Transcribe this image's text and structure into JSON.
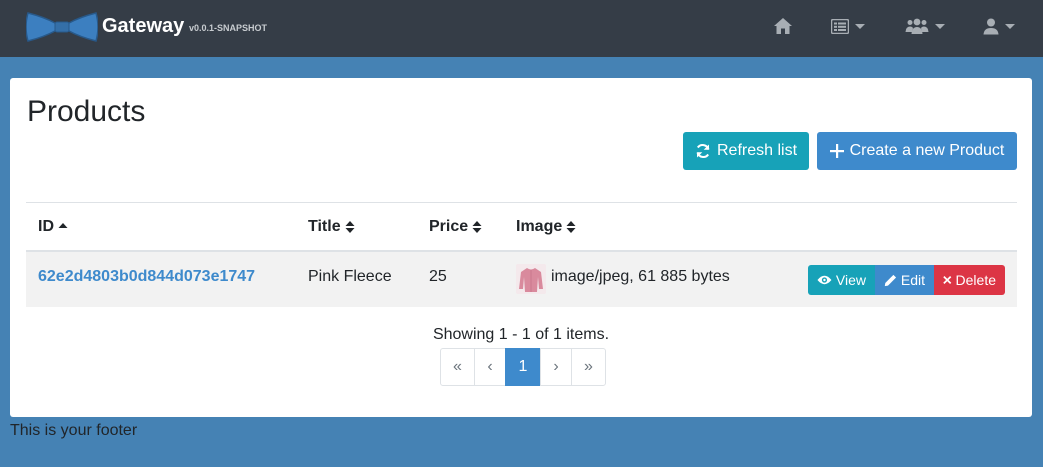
{
  "navbar": {
    "brand_name": "Gateway",
    "version": "v0.0.1-SNAPSHOT",
    "items": [
      {
        "icon": "home-icon"
      },
      {
        "icon": "entities-icon"
      },
      {
        "icon": "admin-users-icon"
      },
      {
        "icon": "account-icon"
      }
    ]
  },
  "page": {
    "title": "Products",
    "refresh_label": "Refresh list",
    "create_label": "Create a new Product"
  },
  "table": {
    "headers": {
      "id": "ID",
      "title": "Title",
      "price": "Price",
      "image": "Image"
    },
    "rows": [
      {
        "id": "62e2d4803b0d844d073e1747",
        "title": "Pink Fleece",
        "price": "25",
        "image": "image/jpeg, 61 885 bytes"
      }
    ],
    "actions": {
      "view": "View",
      "edit": "Edit",
      "delete": "Delete"
    }
  },
  "pagination": {
    "summary": "Showing 1 - 1 of 1 items.",
    "first": "«",
    "prev": "‹",
    "current": "1",
    "next": "›",
    "last": "»"
  },
  "footer": {
    "text": "This is your footer"
  },
  "colors": {
    "navbar": "#353d47",
    "background": "#4582b4",
    "info": "#17a2b8",
    "primary": "#3e8acc",
    "danger": "#dc3545"
  }
}
